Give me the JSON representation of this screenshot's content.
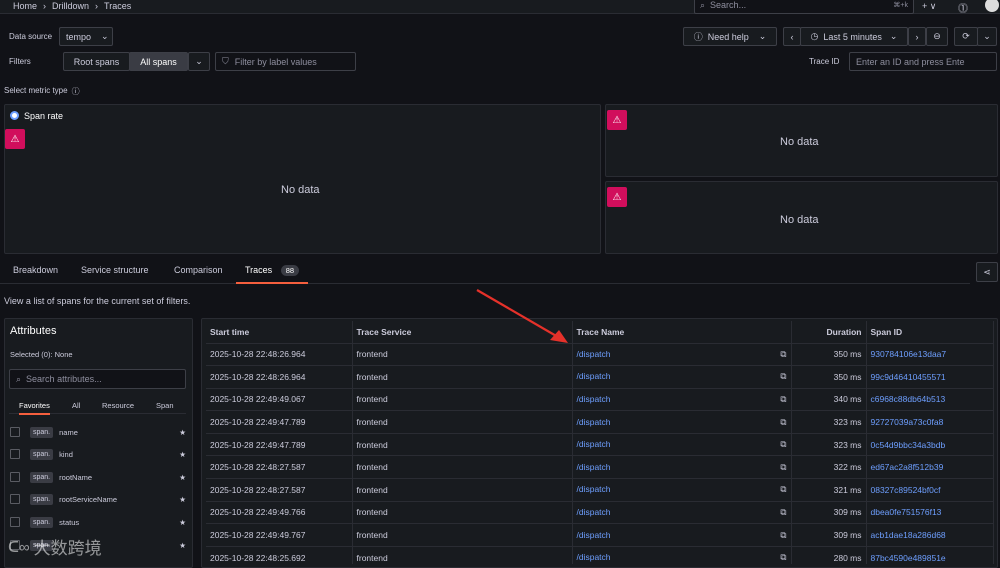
{
  "nav": {
    "crumbs": [
      "Home",
      "Drilldown",
      "Traces"
    ],
    "search_placeholder": "Search...",
    "search_shortcut": "⌘+k",
    "plus": "+ ∨"
  },
  "controls": {
    "datasource_label": "Data source",
    "datasource_value": "tempo",
    "need_help": "Need help",
    "time_range": "Last 5 minutes",
    "filters_label": "Filters",
    "root_spans": "Root spans",
    "all_spans": "All spans",
    "filter_placeholder": "Filter by label values",
    "trace_id_label": "Trace ID",
    "trace_id_placeholder": "Enter an ID and press Ente"
  },
  "metric": {
    "label": "Select metric type",
    "span_rate": "Span rate",
    "no_data": "No data"
  },
  "tabs": [
    {
      "label": "Breakdown"
    },
    {
      "label": "Service structure"
    },
    {
      "label": "Comparison"
    },
    {
      "label": "Traces",
      "badge": "88"
    }
  ],
  "description": "View a list of spans for the current set of filters.",
  "attributes": {
    "title": "Attributes",
    "selected": "Selected (0): None",
    "search_placeholder": "Search attributes...",
    "tabs": [
      "Favorites",
      "All",
      "Resource",
      "Span"
    ],
    "items": [
      {
        "chip": "span.",
        "name": "name"
      },
      {
        "chip": "span.",
        "name": "kind"
      },
      {
        "chip": "span.",
        "name": "rootName"
      },
      {
        "chip": "span.",
        "name": "rootServiceName"
      },
      {
        "chip": "span.",
        "name": "status"
      },
      {
        "chip": "span.",
        "name": ""
      }
    ]
  },
  "table": {
    "headers": [
      "Start time",
      "Trace Service",
      "Trace Name",
      "Duration",
      "Span ID"
    ],
    "rows": [
      [
        "2025-10-28 22:48:26.964",
        "frontend",
        "/dispatch",
        "350 ms",
        "930784106e13daa7"
      ],
      [
        "2025-10-28 22:48:26.964",
        "frontend",
        "/dispatch",
        "350 ms",
        "99c9d46410455571"
      ],
      [
        "2025-10-28 22:49:49.067",
        "frontend",
        "/dispatch",
        "340 ms",
        "c6968c88db64b513"
      ],
      [
        "2025-10-28 22:49:47.789",
        "frontend",
        "/dispatch",
        "323 ms",
        "92727039a73c0fa8"
      ],
      [
        "2025-10-28 22:49:47.789",
        "frontend",
        "/dispatch",
        "323 ms",
        "0c54d9bbc34a3bdb"
      ],
      [
        "2025-10-28 22:48:27.587",
        "frontend",
        "/dispatch",
        "322 ms",
        "ed67ac2a8f512b39"
      ],
      [
        "2025-10-28 22:48:27.587",
        "frontend",
        "/dispatch",
        "321 ms",
        "08327c89524bf0cf"
      ],
      [
        "2025-10-28 22:49:49.766",
        "frontend",
        "/dispatch",
        "309 ms",
        "dbea0fe751576f13"
      ],
      [
        "2025-10-28 22:49:49.767",
        "frontend",
        "/dispatch",
        "309 ms",
        "acb1dae18a286d68"
      ],
      [
        "2025-10-28 22:48:25.692",
        "frontend",
        "/dispatch",
        "280 ms",
        "87bc4590e489851e"
      ]
    ]
  },
  "watermark": "大数跨境",
  "colors": {
    "accent": "#6e9fff",
    "warning": "#d10e5c",
    "arrow": "#e5312a"
  }
}
